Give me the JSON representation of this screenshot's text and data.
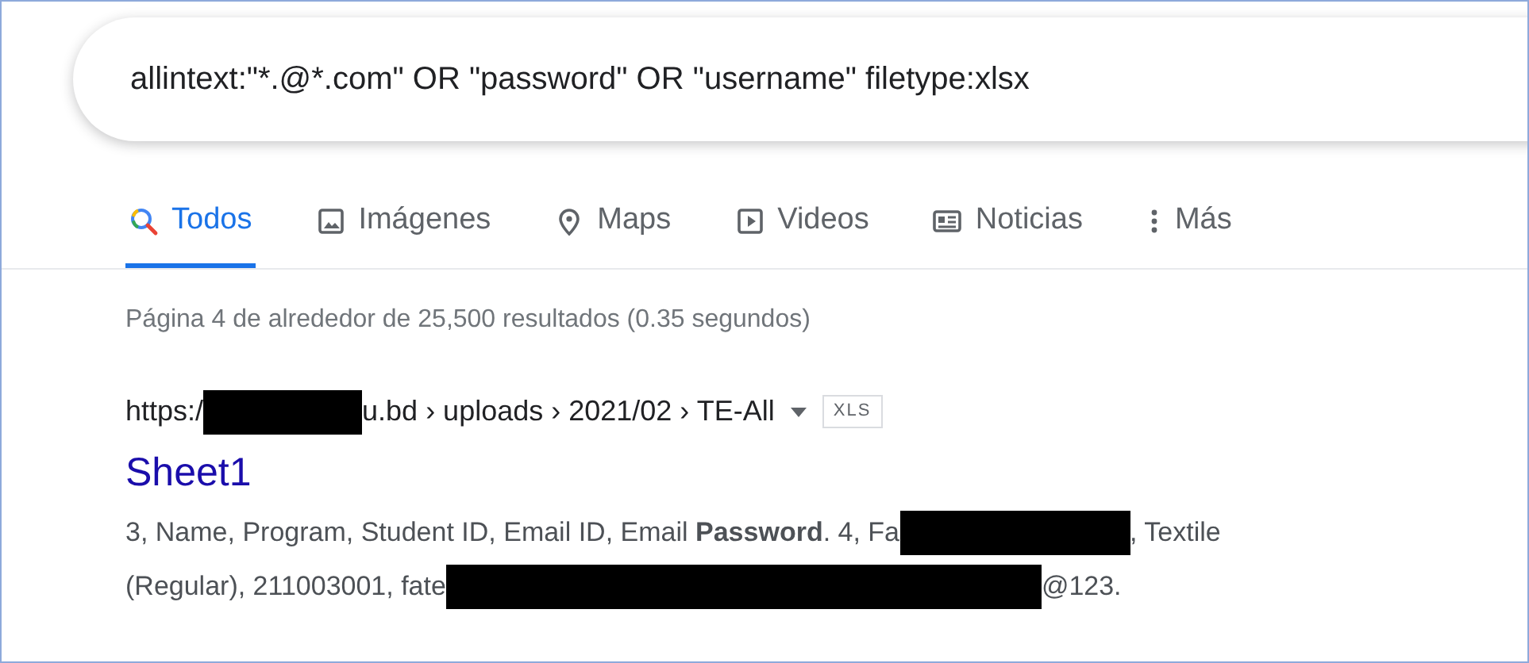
{
  "search": {
    "query": "allintext:\"*.@*.com\" OR \"password\" OR \"username\" filetype:xlsx"
  },
  "tabs": [
    {
      "label": "Todos",
      "kind": "search",
      "selected": true
    },
    {
      "label": "Imágenes",
      "kind": "image",
      "selected": false
    },
    {
      "label": "Maps",
      "kind": "pin",
      "selected": false
    },
    {
      "label": "Videos",
      "kind": "play",
      "selected": false
    },
    {
      "label": "Noticias",
      "kind": "news",
      "selected": false
    },
    {
      "label": "Más",
      "kind": "more",
      "selected": false
    }
  ],
  "result_stats": "Página 4 de alrededor de 25,500 resultados (0.35 segundos)",
  "result": {
    "url_parts": [
      {
        "kind": "text",
        "text": "https:/"
      },
      {
        "kind": "redacted"
      },
      {
        "kind": "text",
        "text": "u.bd › uploads › 2021/02 › TE-All"
      }
    ],
    "file_type": "XLS",
    "title": "Sheet1",
    "snippet_lines": [
      [
        {
          "kind": "text",
          "text": "3, Name, Program, Student ID, Email ID, Email **Password**. 4, Fa"
        },
        {
          "kind": "redacted"
        },
        {
          "kind": "text",
          "text": ", Textile"
        }
      ],
      [
        {
          "kind": "text",
          "text": "(Regular), 211003001, fate"
        },
        {
          "kind": "redacted"
        },
        {
          "kind": "text",
          "text": "@123."
        }
      ]
    ]
  }
}
